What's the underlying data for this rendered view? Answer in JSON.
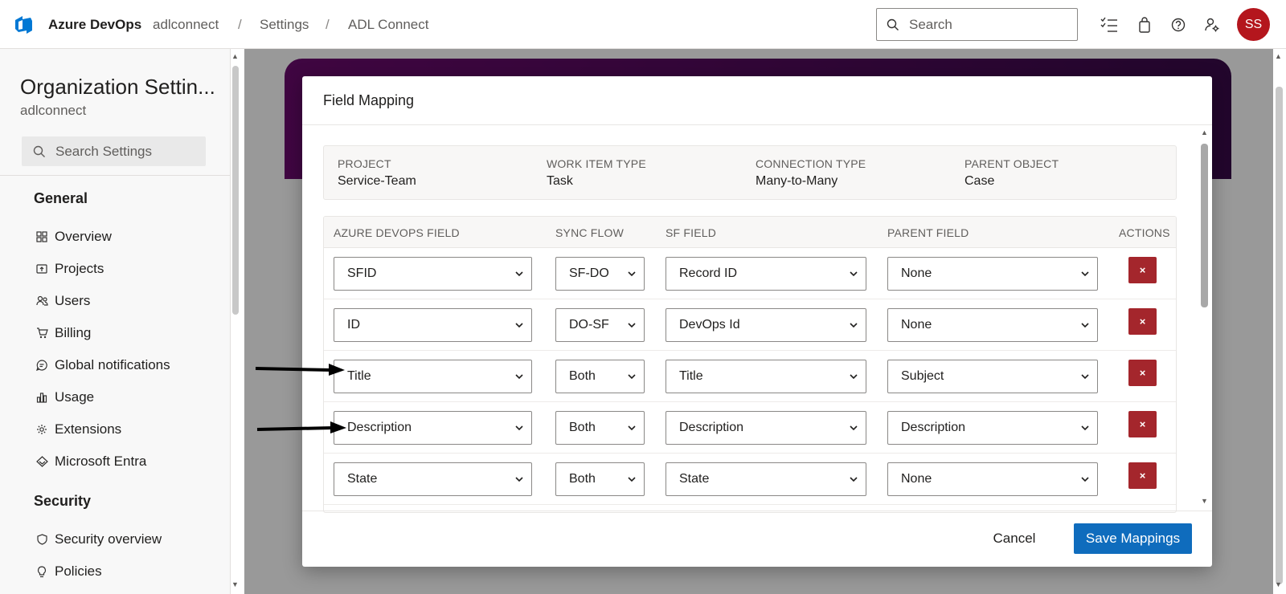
{
  "topbar": {
    "brand": "Azure DevOps",
    "breadcrumbs": [
      "adlconnect",
      "Settings",
      "ADL Connect"
    ],
    "search_placeholder": "Search",
    "avatar_initials": "SS",
    "avatar_color": "#b4161d",
    "icons": [
      "checklist-icon",
      "shopping-bag-icon",
      "help-icon",
      "user-settings-icon"
    ]
  },
  "sidebar": {
    "title": "Organization Settin...",
    "subtitle": "adlconnect",
    "search_placeholder": "Search Settings",
    "sections": [
      {
        "label": "General",
        "items": [
          {
            "label": "Overview",
            "icon": "overview-icon"
          },
          {
            "label": "Projects",
            "icon": "projects-icon"
          },
          {
            "label": "Users",
            "icon": "users-icon"
          },
          {
            "label": "Billing",
            "icon": "cart-icon"
          },
          {
            "label": "Global notifications",
            "icon": "chat-icon"
          },
          {
            "label": "Usage",
            "icon": "chart-icon"
          },
          {
            "label": "Extensions",
            "icon": "gear-icon"
          },
          {
            "label": "Microsoft Entra",
            "icon": "entra-icon"
          }
        ]
      },
      {
        "label": "Security",
        "items": [
          {
            "label": "Security overview",
            "icon": "shield-icon"
          },
          {
            "label": "Policies",
            "icon": "lightbulb-icon"
          }
        ]
      }
    ]
  },
  "modal": {
    "title": "Field Mapping",
    "info": {
      "project_label": "PROJECT",
      "project_value": "Service-Team",
      "work_item_type_label": "WORK ITEM TYPE",
      "work_item_type_value": "Task",
      "connection_type_label": "CONNECTION TYPE",
      "connection_type_value": "Many-to-Many",
      "parent_object_label": "PARENT OBJECT",
      "parent_object_value": "Case"
    },
    "columns": [
      "AZURE DEVOPS FIELD",
      "SYNC FLOW",
      "SF FIELD",
      "PARENT FIELD",
      "ACTIONS"
    ],
    "rows": [
      {
        "ado_field": "SFID",
        "sync_flow": "SF-DO",
        "sf_field": "Record ID",
        "parent_field": "None"
      },
      {
        "ado_field": "ID",
        "sync_flow": "DO-SF",
        "sf_field": "DevOps Id",
        "parent_field": "None"
      },
      {
        "ado_field": "Title",
        "sync_flow": "Both",
        "sf_field": "Title",
        "parent_field": "Subject"
      },
      {
        "ado_field": "Description",
        "sync_flow": "Both",
        "sf_field": "Description",
        "parent_field": "Description"
      },
      {
        "ado_field": "State",
        "sync_flow": "Both",
        "sf_field": "State",
        "parent_field": "None"
      }
    ],
    "delete_glyph": "×",
    "cancel_label": "Cancel",
    "save_label": "Save Mappings",
    "save_color": "#0f6cbd",
    "delete_color": "#a4262c"
  }
}
